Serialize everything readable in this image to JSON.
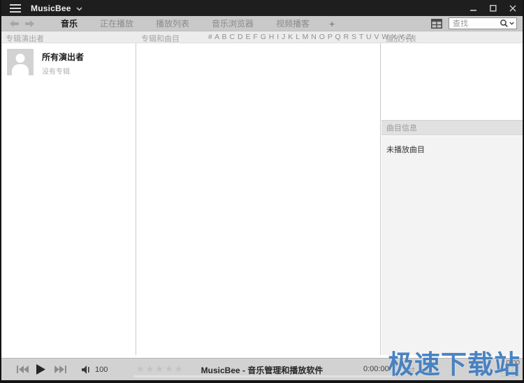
{
  "window": {
    "title": "MusicBee"
  },
  "tabbar": {
    "tabs": [
      {
        "label": "音乐",
        "active": true
      },
      {
        "label": "正在播放",
        "active": false
      },
      {
        "label": "播放列表",
        "active": false
      },
      {
        "label": "音乐浏览器",
        "active": false
      },
      {
        "label": "视频播客",
        "active": false
      }
    ],
    "add_tab_label": "+",
    "search_placeholder": "查找"
  },
  "panels": {
    "artists": {
      "header": "专辑演出者",
      "items": [
        {
          "name": "所有演出者",
          "subtitle": "没有专辑"
        }
      ]
    },
    "albums": {
      "header": "专辑和曲目",
      "alphabet": "# A B C D E F G H I J K L M N O P Q R S T U V W X Y Z"
    },
    "playlist": {
      "header": "播放列表"
    },
    "track_info": {
      "header": "曲目信息",
      "status": "未播放曲目"
    }
  },
  "player": {
    "volume": "100",
    "rating": "★★★★★",
    "status_text": "MusicBee - 音乐管理和播放软件",
    "time_elapsed": "0:00:00",
    "time_total": "0:00",
    "shuffle_glyph": "⇄",
    "repeat_glyph": "↻"
  },
  "watermark": {
    "text": "极速下载站"
  },
  "colors": {
    "titlebar_bg": "#1e1e1e",
    "tabbar_bg": "#c9c9c9",
    "header_strip_bg": "#ececec",
    "player_bg": "#d2d2d2",
    "watermark_blue": "#3a78be"
  }
}
